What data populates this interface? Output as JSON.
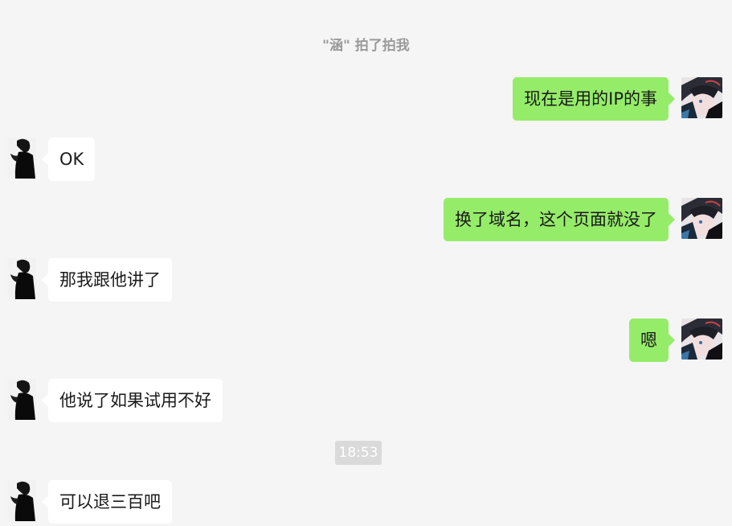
{
  "system_notice": "\"涵\" 拍了拍我",
  "timestamp": "18:53",
  "colors": {
    "background": "#f5f5f5",
    "my_bubble": "#95ec69",
    "their_bubble": "#ffffff",
    "system_text": "#9a9a9a"
  },
  "messages": [
    {
      "sender": "me",
      "text": "现在是用的IP的事",
      "avatar": "anime-avatar-icon"
    },
    {
      "sender": "them",
      "text": "OK",
      "avatar": "silhouette-avatar-icon"
    },
    {
      "sender": "me",
      "text": "换了域名，这个页面就没了",
      "avatar": "anime-avatar-icon"
    },
    {
      "sender": "them",
      "text": "那我跟他讲了",
      "avatar": "silhouette-avatar-icon"
    },
    {
      "sender": "me",
      "text": "嗯",
      "avatar": "anime-avatar-icon"
    },
    {
      "sender": "them",
      "text": "他说了如果试用不好",
      "avatar": "silhouette-avatar-icon"
    },
    {
      "sender": "them",
      "text": "可以退三百吧",
      "avatar": "silhouette-avatar-icon"
    }
  ]
}
